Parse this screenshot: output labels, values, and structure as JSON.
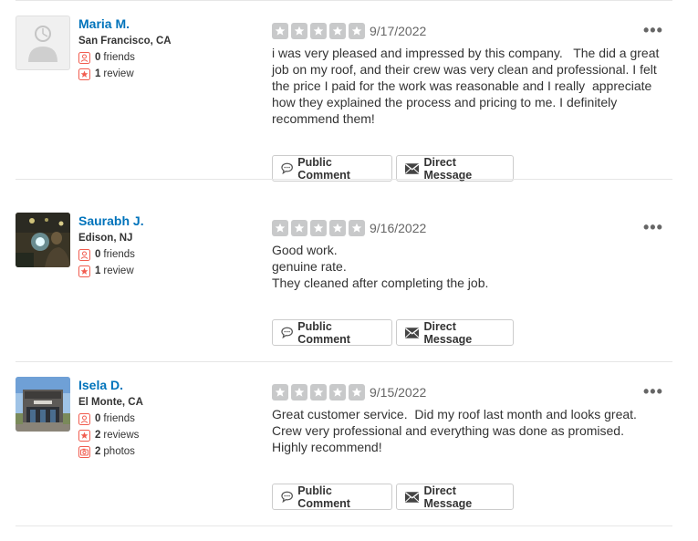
{
  "buttons": {
    "public_comment": "Public Comment",
    "direct_message": "Direct Message"
  },
  "reviews": [
    {
      "user": {
        "name": "Maria M.",
        "location": "San Francisco, CA",
        "friends_count": "0",
        "friends_label": "friends",
        "reviews_count": "1",
        "reviews_label": "review"
      },
      "rating": 5,
      "date": "9/17/2022",
      "text": "i was very pleased and impressed by this company.   The did a great job on my roof, and their crew was very clean and professional. I felt the price I paid for the work was reasonable and I really  appreciate how they explained the process and pricing to me. I definitely recommend them!"
    },
    {
      "user": {
        "name": "Saurabh J.",
        "location": "Edison, NJ",
        "friends_count": "0",
        "friends_label": "friends",
        "reviews_count": "1",
        "reviews_label": "review"
      },
      "rating": 5,
      "date": "9/16/2022",
      "text": "Good work.\ngenuine rate.\nThey cleaned after completing the job."
    },
    {
      "user": {
        "name": "Isela D.",
        "location": "El Monte, CA",
        "friends_count": "0",
        "friends_label": "friends",
        "reviews_count": "2",
        "reviews_label": "reviews",
        "photos_count": "2",
        "photos_label": "photos"
      },
      "rating": 5,
      "date": "9/15/2022",
      "text": "Great customer service.  Did my roof last month and looks great.  Crew very professional and everything was done as promised.\nHighly recommend!"
    }
  ],
  "colors": {
    "link": "#0073bb",
    "star_empty": "#c8c9ca",
    "stat_icon": "#f15c4f"
  }
}
